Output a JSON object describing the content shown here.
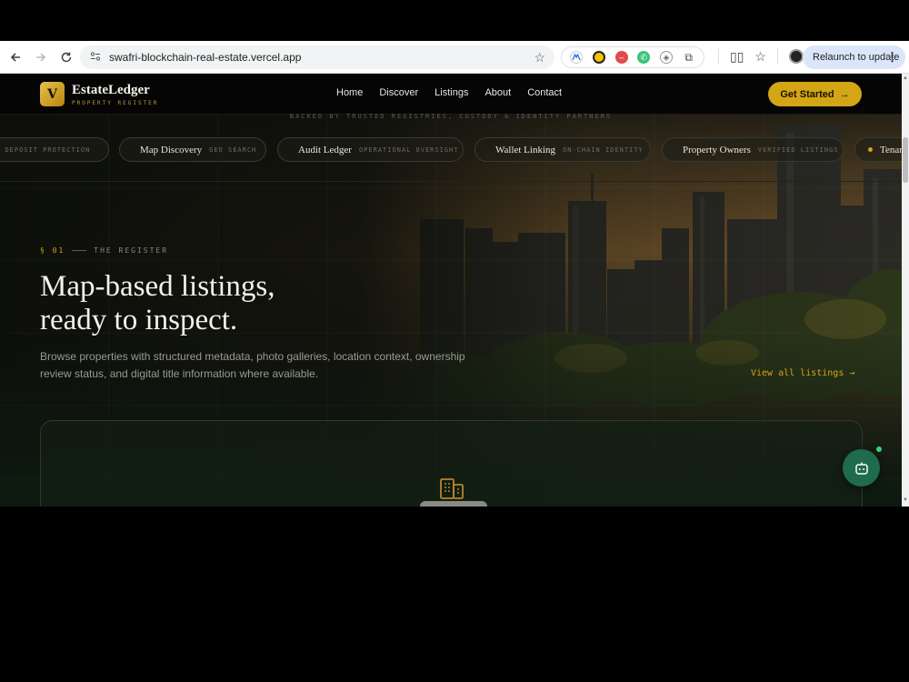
{
  "browser": {
    "url": "swafri-blockchain-real-estate.vercel.app",
    "relaunch_label": "Relaunch to update"
  },
  "site": {
    "logo_letter": "V",
    "name": "EstateLedger",
    "tagline": "PROPERTY REGISTER",
    "nav": [
      "Home",
      "Discover",
      "Listings",
      "About",
      "Contact"
    ],
    "cta_label": "Get Started"
  },
  "trust": {
    "backed_text": "BACKED BY TRUSTED REGISTRIES, CUSTODY & IDENTITY PARTNERS"
  },
  "marquee": [
    {
      "name": "",
      "sub": "DEPOSIT PROTECTION",
      "partial": "w"
    },
    {
      "name": "Map Discovery",
      "sub": "GEO SEARCH"
    },
    {
      "name": "Audit Ledger",
      "sub": "OPERATIONAL OVERSIGHT"
    },
    {
      "name": "Wallet Linking",
      "sub": "ON-CHAIN IDENTITY"
    },
    {
      "name": "Property Owners",
      "sub": "VERIFIED LISTINGS"
    },
    {
      "name": "Tenan",
      "sub": ""
    }
  ],
  "section": {
    "number": "§ 01",
    "label": "THE REGISTER",
    "headline_line1": "Map-based listings,",
    "headline_line2": "ready to inspect.",
    "description": "Browse properties with structured metadata, photo galleries, location context, ownership review status, and digital title information where available.",
    "view_all_label": "View all listings"
  },
  "colors": {
    "accent": "#d4a514",
    "background": "#0d0f0b",
    "chat_button": "#1e6b4e"
  }
}
